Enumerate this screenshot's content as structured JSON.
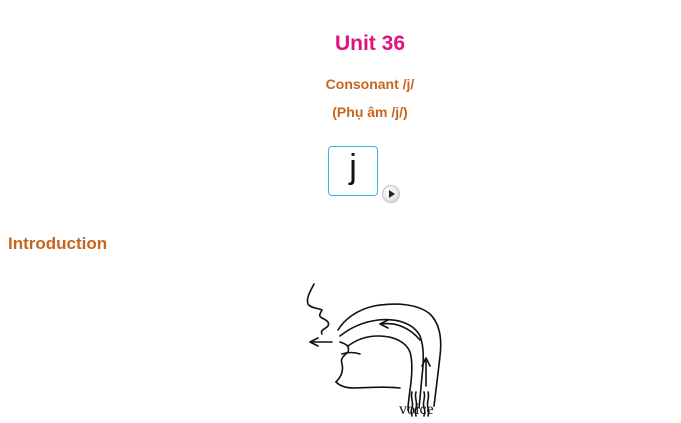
{
  "header": {
    "unit_title": "Unit 36",
    "subtitle_en": "Consonant /j/",
    "subtitle_vi": "(Phụ âm /j/)"
  },
  "phoneme": {
    "symbol": "j",
    "play_icon": "play-icon"
  },
  "section": {
    "heading": "Introduction"
  },
  "diagram": {
    "label": "voice"
  },
  "colors": {
    "title": "#e0127e",
    "subtitle": "#c8651b",
    "box_border": "#38b6e8"
  }
}
